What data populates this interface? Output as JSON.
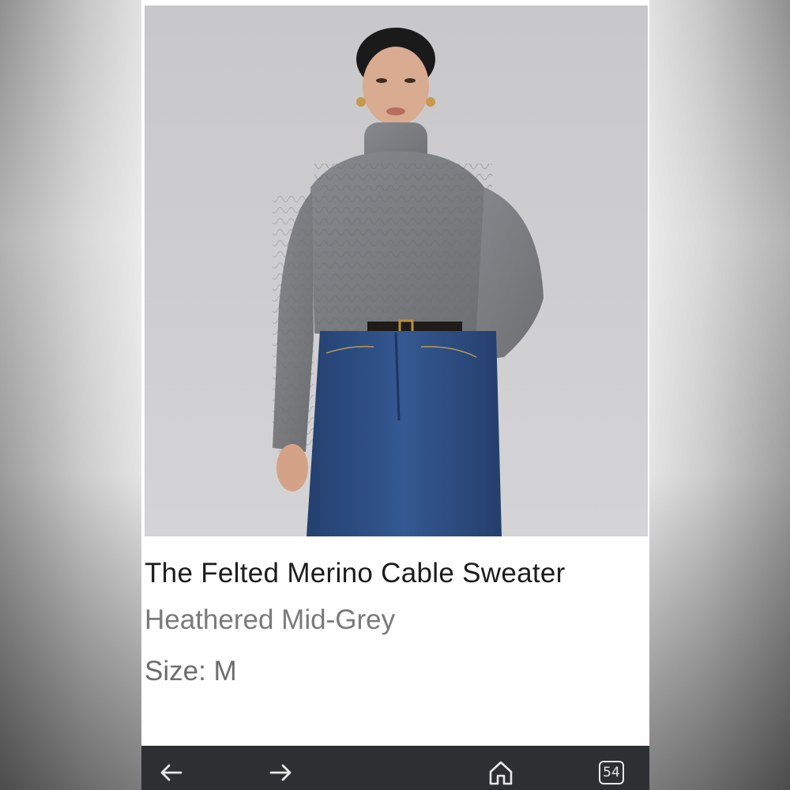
{
  "product": {
    "title": "The Felted Merino Cable Sweater",
    "color": "Heathered Mid-Grey",
    "size": "Size: M"
  },
  "image": {
    "subject": "model-wearing-grey-cable-knit-turtleneck-and-blue-jeans"
  },
  "browser_nav": {
    "back_icon": "arrow-left-icon",
    "forward_icon": "arrow-right-icon",
    "home_icon": "home-icon",
    "tab_count": "54"
  },
  "colors": {
    "nav_background": "#2e2f33",
    "title_text": "#1c1c1c",
    "secondary_text": "#7a7a7a",
    "sweater": "#7b7d82",
    "denim": "#2f4f8a"
  }
}
